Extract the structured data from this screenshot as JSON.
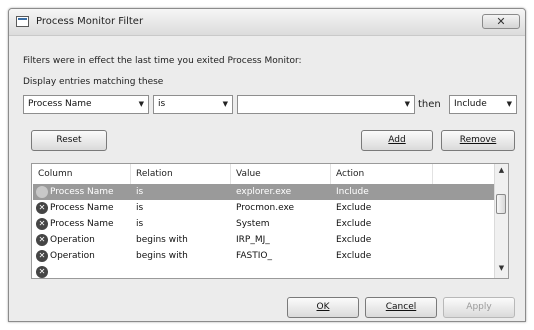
{
  "window": {
    "title": "Process Monitor Filter",
    "close_glyph": "✕"
  },
  "info_text": "Filters were in effect the last time you exited Process Monitor:",
  "display_label": "Display entries matching these",
  "filter_builder": {
    "column_value": "Process Name",
    "relation_value": "is",
    "value_value": "",
    "then_label": "then",
    "action_value": "Include"
  },
  "buttons": {
    "reset": "Reset",
    "add": "Add",
    "remove": "Remove",
    "ok": "OK",
    "cancel": "Cancel",
    "apply": "Apply"
  },
  "table": {
    "headers": [
      "Column",
      "Relation",
      "Value",
      "Action"
    ],
    "rows": [
      {
        "column": "Process Name",
        "relation": "is",
        "value": "explorer.exe",
        "action": "Include",
        "selected": true
      },
      {
        "column": "Process Name",
        "relation": "is",
        "value": "Procmon.exe",
        "action": "Exclude",
        "selected": false
      },
      {
        "column": "Process Name",
        "relation": "is",
        "value": "System",
        "action": "Exclude",
        "selected": false
      },
      {
        "column": "Operation",
        "relation": "begins with",
        "value": "IRP_MJ_",
        "action": "Exclude",
        "selected": false
      },
      {
        "column": "Operation",
        "relation": "begins with",
        "value": "FASTIO_",
        "action": "Exclude",
        "selected": false
      }
    ]
  },
  "icons": {
    "exclude_icon": "x-circle-icon",
    "include_icon": "check-circle-icon"
  },
  "colors": {
    "selected_row": "#9a9a9a",
    "dialog_bg": "#ececec"
  }
}
